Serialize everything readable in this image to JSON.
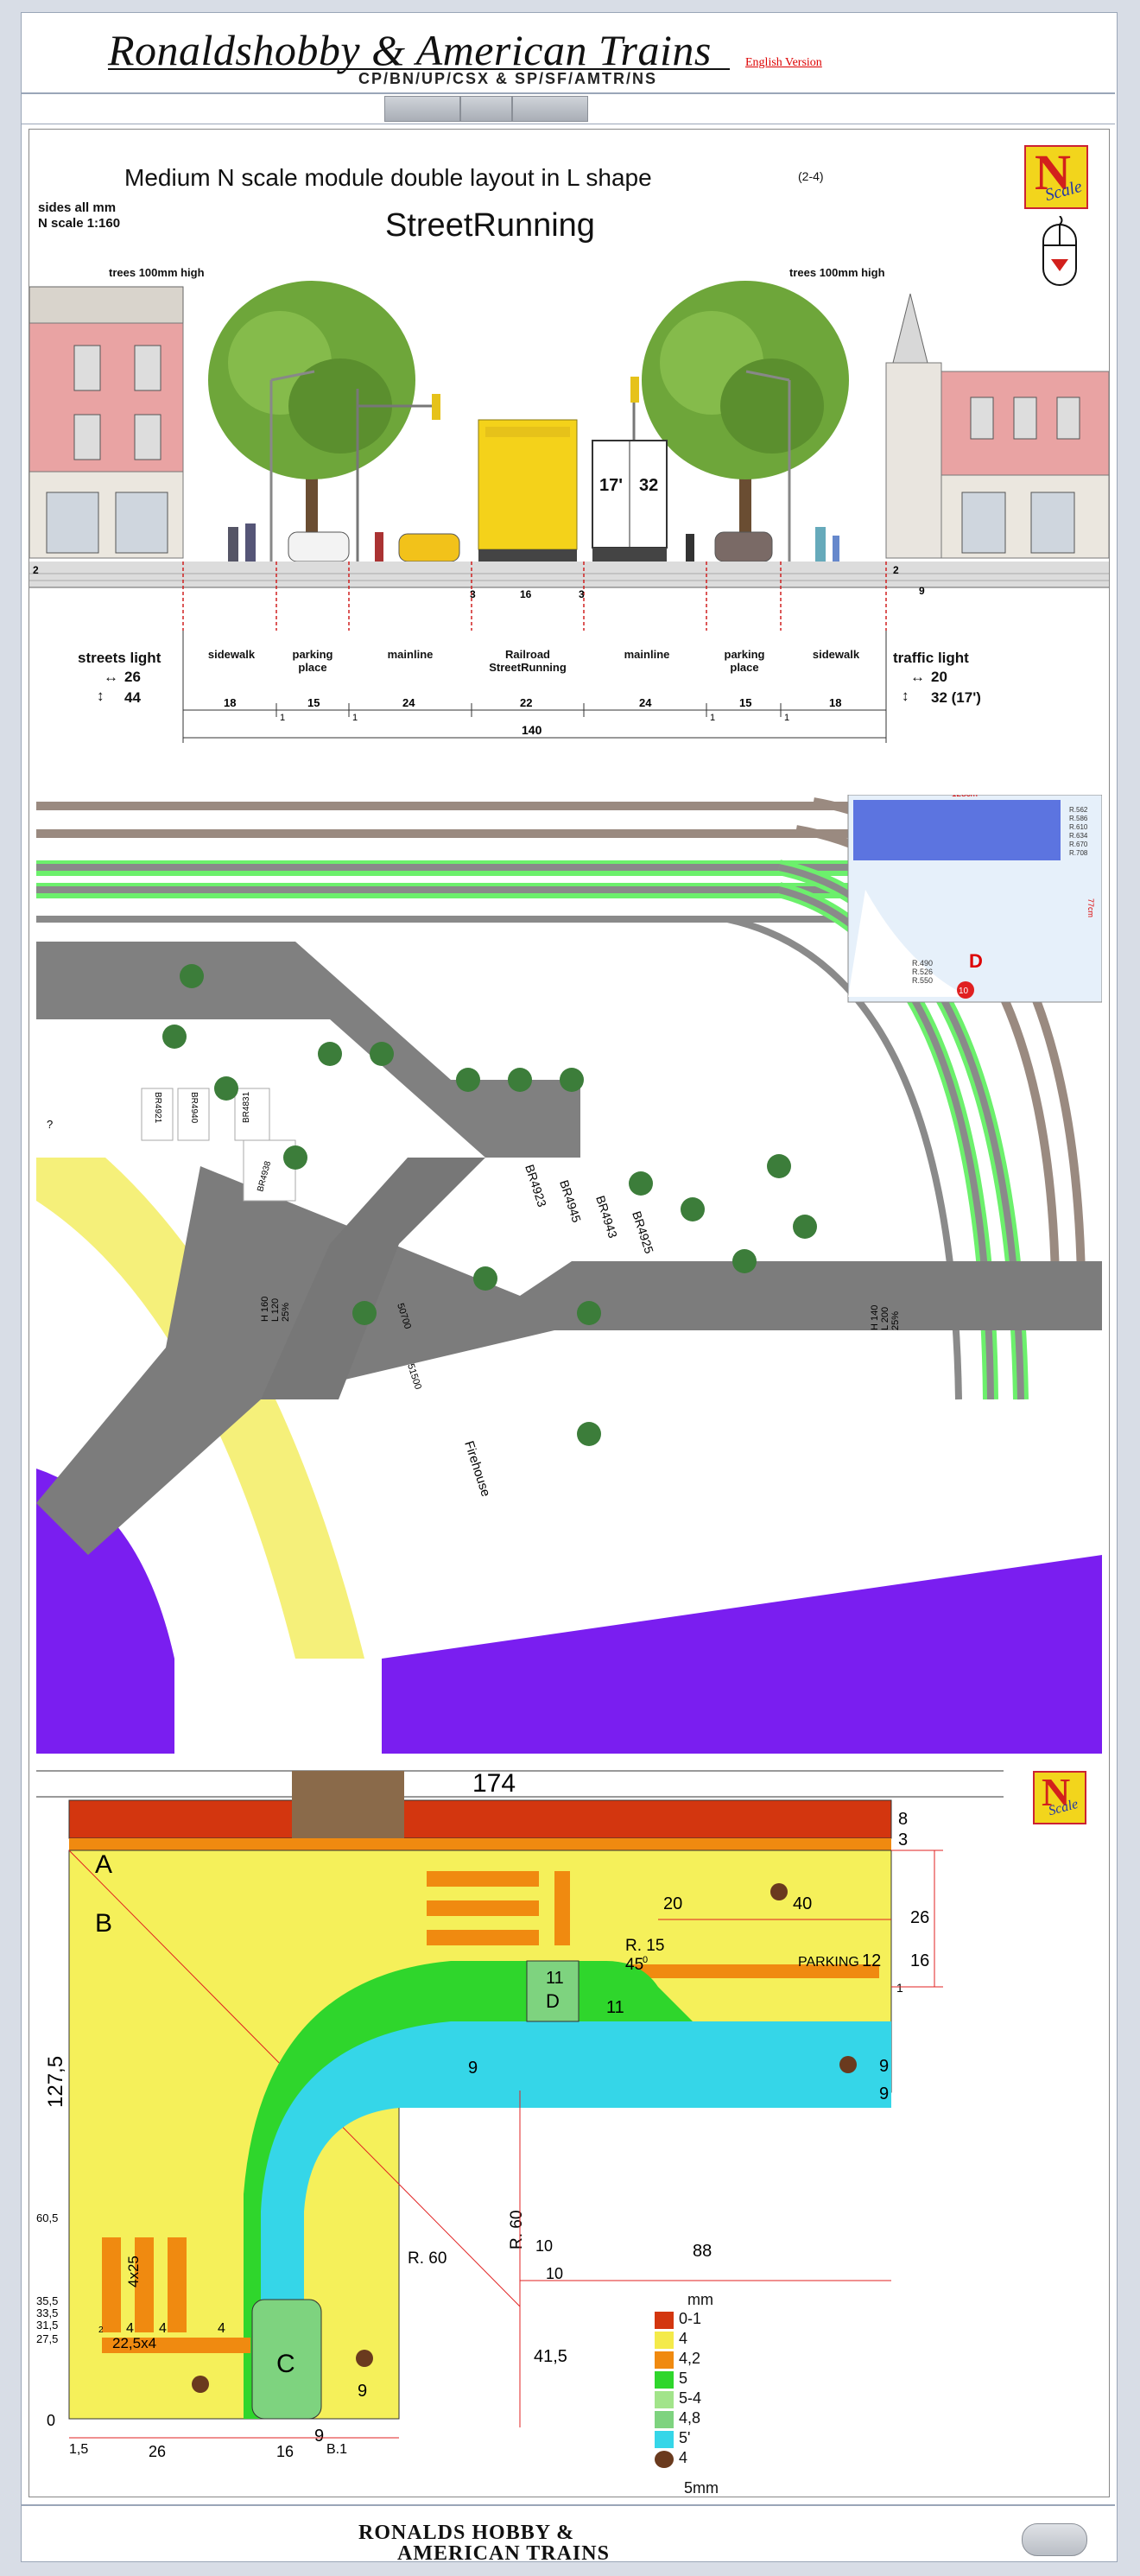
{
  "header": {
    "site_title": "Ronaldshobby & American Trains",
    "railroads": "CP/BN/UP/CSX & SP/SF/AMTR/NS",
    "english_link": "English Version"
  },
  "section1": {
    "title": "Medium N scale module double layout in L shape",
    "title_suffix": "(2-4)",
    "sides": "sides all mm",
    "scale": "N scale 1:160",
    "subtitle": "StreetRunning",
    "trees_left": "trees 100mm high",
    "trees_right": "trees 100mm high",
    "badge_letter": "N",
    "badge_word": "Scale",
    "truck_label_a": "17'",
    "truck_label_b": "32",
    "street_labels": [
      {
        "label": "sidewalk",
        "width": "18"
      },
      {
        "label": "parking place",
        "width": "15"
      },
      {
        "label": "mainline",
        "width": "24"
      },
      {
        "label": "Railroad StreetRunning",
        "width": "22"
      },
      {
        "label": "mainline",
        "width": "24"
      },
      {
        "label": "parking place",
        "width": "15"
      },
      {
        "label": "sidewalk",
        "width": "18"
      }
    ],
    "gaps": [
      "1",
      "1",
      "3",
      "3",
      "1",
      "1"
    ],
    "center_mark": "16",
    "left_level_2": "2",
    "right_level_2": "2",
    "right_level_9": "9",
    "total": "140",
    "streets_light": "streets light",
    "streets_light_h": "26",
    "streets_light_v": "44",
    "traffic_light": "traffic light",
    "traffic_light_h": "20",
    "traffic_light_v": "32 (17')"
  },
  "section2": {
    "buildings": [
      "BR4921",
      "BR4940",
      "BR4831",
      "BR4938",
      "BR4923",
      "BR4945",
      "BR4943",
      "BR4925",
      "50700",
      "51500",
      "Firehouse"
    ],
    "unknown_building": "?",
    "dim_left": [
      "H 160",
      "L 120",
      "25%"
    ],
    "dim_right": [
      "H 140",
      "L 200",
      "25%"
    ],
    "inset": {
      "width_label": "128cm",
      "height_label": "77cm",
      "radii_left": [
        "R.490",
        "R.526",
        "R.550"
      ],
      "radii_right": [
        "R.562",
        "R.586",
        "R.610",
        "R.634",
        "R.670",
        "R.708"
      ],
      "letter": "D",
      "badge": "10"
    }
  },
  "section3": {
    "width_total": "174",
    "top_right_8": "8",
    "top_right_3": "3",
    "letters": [
      "A",
      "B",
      "C",
      "D"
    ],
    "height_total": "127,5",
    "dims": {
      "d26": "26",
      "d16": "16",
      "d1": "1",
      "d20": "20",
      "d40": "40",
      "parking": "PARKING",
      "parking_num": "12",
      "r15": "R. 15",
      "angle": "45",
      "angle_unit": "0",
      "d11a": "11",
      "d11b": "11",
      "r60v": "R. 60",
      "r60h": "R. 60",
      "d10a": "10",
      "d10b": "10",
      "d88": "88",
      "d41_5": "41,5",
      "d4x25": "4x25",
      "d22_5x4": "22,5x4",
      "d4": "4",
      "d2": "2",
      "bottom_26": "26",
      "bottom_16": "16",
      "bottom_15": "1,5",
      "bottom_b1": "B.1",
      "nine": "9"
    },
    "left_levels": [
      "60,5",
      "35,5",
      "33,5",
      "31,5",
      "27,5",
      "0"
    ],
    "legend": {
      "unit": "mm",
      "entries": [
        {
          "label": "0-1",
          "color": "#d3360f"
        },
        {
          "label": "4",
          "color": "#f4ea4a"
        },
        {
          "label": "4,2",
          "color": "#f08a10"
        },
        {
          "label": "5",
          "color": "#2fd62c"
        },
        {
          "label": "5-4",
          "color": "#a2e48a"
        },
        {
          "label": "4,8",
          "color": "#7ed37f"
        },
        {
          "label": "5'",
          "color": "#35d6e8"
        },
        {
          "label": "4",
          "color": "#6a3a1e"
        }
      ],
      "scale": "5mm"
    }
  },
  "footer": {
    "logo_line1": "RONALDS HOBBY &",
    "logo_line2": "AMERICAN TRAINS"
  },
  "colors": {
    "yellow": "#f5f05a",
    "orange": "#f08a10",
    "red": "#d3360f",
    "cyan": "#35d6e8",
    "green": "#2fd62c",
    "light_green": "#8fd88f",
    "purple": "#7a1ef0",
    "track_green": "#6cf06c"
  }
}
